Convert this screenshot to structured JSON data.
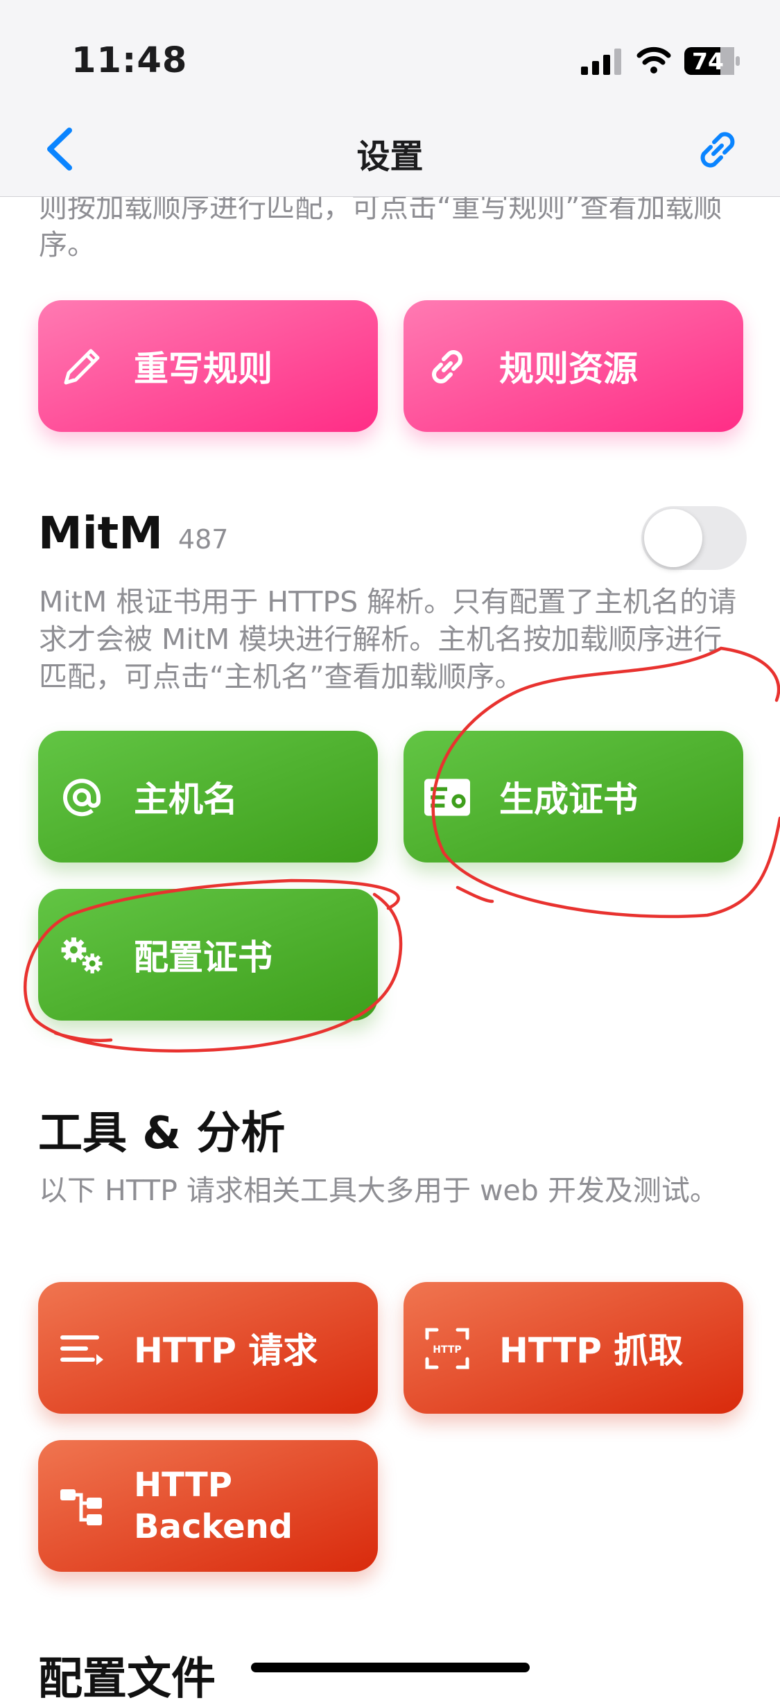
{
  "status_bar": {
    "time": "11:48",
    "battery": "74"
  },
  "nav": {
    "title": "设置"
  },
  "rewrite": {
    "description": "则按加载顺序进行匹配，可点击“重写规则”查看加载顺序。",
    "buttons": [
      {
        "label": "重写规则",
        "icon": "pencil-icon"
      },
      {
        "label": "规则资源",
        "icon": "link-icon"
      }
    ],
    "color": "#ff2d86"
  },
  "mitm": {
    "title": "MitM",
    "count": "487",
    "enabled": false,
    "description": "MitM 根证书用于 HTTPS 解析。只有配置了主机名的请求才会被 MitM 模块进行解析。主机名按加载顺序进行匹配，可点击“主机名”查看加载顺序。",
    "buttons": [
      {
        "label": "主机名",
        "icon": "at-icon"
      },
      {
        "label": "生成证书",
        "icon": "certificate-icon"
      },
      {
        "label": "配置证书",
        "icon": "gears-icon"
      }
    ],
    "color": "#3e9f1c"
  },
  "tools": {
    "title": "工具 & 分析",
    "description": "以下 HTTP 请求相关工具大多用于 web 开发及测试。",
    "buttons": [
      {
        "label": "HTTP 请求",
        "icon": "list-arrow-icon"
      },
      {
        "label": "HTTP 抓取",
        "icon": "http-capture-icon"
      },
      {
        "label": "HTTP Backend",
        "icon": "tree-icon"
      }
    ],
    "color": "#d92a0c"
  },
  "config": {
    "title": "配置文件"
  },
  "annotation_color": "#e8322f"
}
